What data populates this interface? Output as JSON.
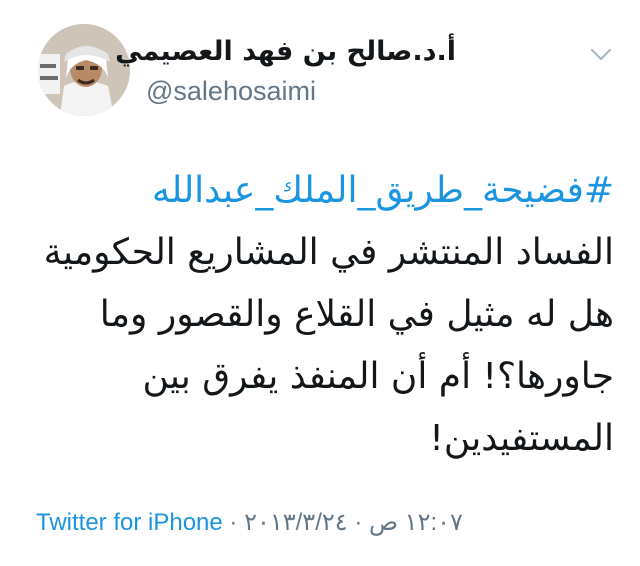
{
  "user": {
    "display_name": "أ.د.صالح بن فهد العصيمي",
    "handle": "@salehosaimi",
    "avatar_icon": "profile-photo"
  },
  "menu": {
    "icon": "chevron-down-icon"
  },
  "tweet": {
    "hashtag": "#فضيحة_طريق_الملك_عبدالله",
    "lines": [
      "الفساد المنتشر في المشاريع الحكومية",
      "هل له مثيل في القلاع والقصور وما",
      "جاورها؟! أم أن المنفذ يفرق بين",
      "المستفيدين!"
    ]
  },
  "meta": {
    "source": "Twitter for iPhone",
    "separator": " · ",
    "date": "٢٠١٣/٣/٢٤",
    "time": "١٢:٠٧ ص"
  },
  "colors": {
    "link": "#1b95e0",
    "secondary": "#657786",
    "text": "#14171a"
  }
}
